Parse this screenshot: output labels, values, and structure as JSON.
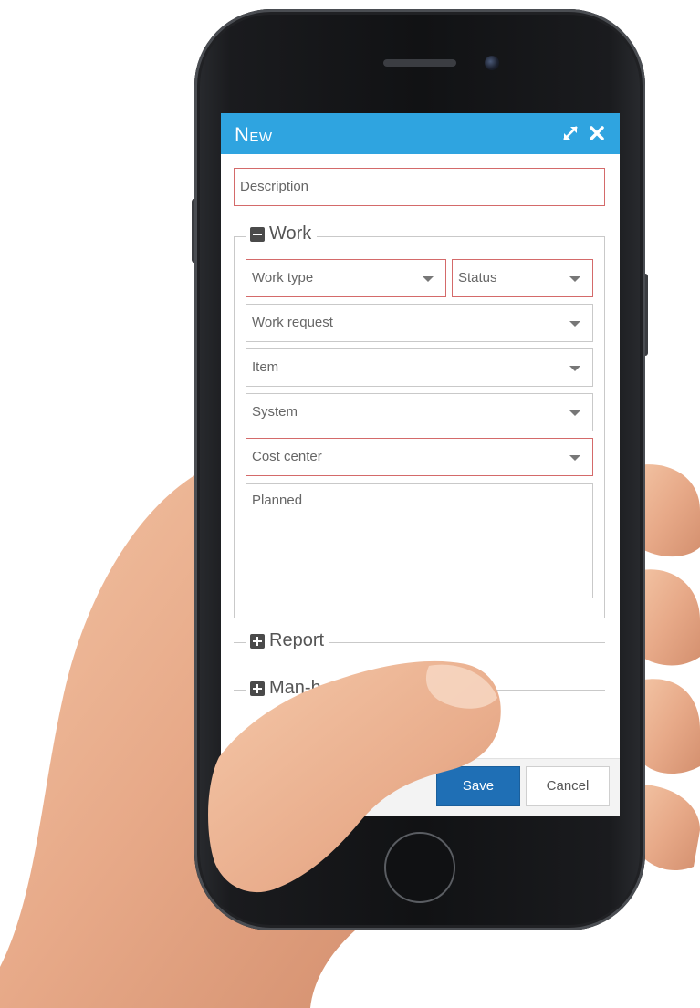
{
  "dialog": {
    "title": "New",
    "expand_icon": "expand-arrows-icon",
    "close_icon": "close-icon"
  },
  "form": {
    "description_placeholder": "Description",
    "sections": [
      {
        "label": "Work",
        "state": "expanded",
        "icon": "minus-square-icon"
      },
      {
        "label": "Report",
        "state": "collapsed",
        "icon": "plus-square-icon"
      },
      {
        "label": "Man-h",
        "state": "collapsed",
        "icon": "plus-square-icon"
      }
    ],
    "work_fields": {
      "work_type": "Work type",
      "status": "Status",
      "work_request": "Work request",
      "item": "Item",
      "system": "System",
      "cost_center": "Cost center",
      "planned": "Planned"
    },
    "required_color": "#d46a6a"
  },
  "footer": {
    "save_label": "Save",
    "cancel_label": "Cancel"
  },
  "colors": {
    "titlebar": "#2fa4e0",
    "save_button": "#1f6fb5"
  }
}
